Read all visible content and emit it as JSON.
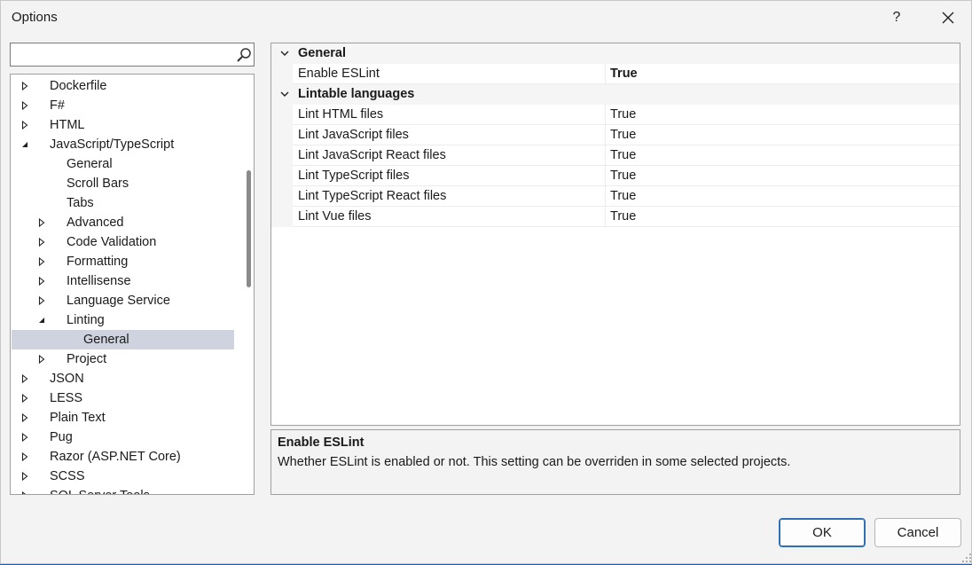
{
  "window": {
    "title": "Options",
    "help_label": "?",
    "close_label": "✕"
  },
  "search": {
    "placeholder": ""
  },
  "tree": {
    "items": [
      {
        "label": "Dockerfile",
        "indent": 0,
        "arrow": "collapsed"
      },
      {
        "label": "F#",
        "indent": 0,
        "arrow": "collapsed"
      },
      {
        "label": "HTML",
        "indent": 0,
        "arrow": "collapsed"
      },
      {
        "label": "JavaScript/TypeScript",
        "indent": 0,
        "arrow": "expanded"
      },
      {
        "label": "General",
        "indent": 1,
        "arrow": "none"
      },
      {
        "label": "Scroll Bars",
        "indent": 1,
        "arrow": "none"
      },
      {
        "label": "Tabs",
        "indent": 1,
        "arrow": "none"
      },
      {
        "label": "Advanced",
        "indent": 1,
        "arrow": "collapsed"
      },
      {
        "label": "Code Validation",
        "indent": 1,
        "arrow": "collapsed"
      },
      {
        "label": "Formatting",
        "indent": 1,
        "arrow": "collapsed"
      },
      {
        "label": "Intellisense",
        "indent": 1,
        "arrow": "collapsed"
      },
      {
        "label": "Language Service",
        "indent": 1,
        "arrow": "collapsed"
      },
      {
        "label": "Linting",
        "indent": 1,
        "arrow": "expanded"
      },
      {
        "label": "General",
        "indent": 2,
        "arrow": "none",
        "selected": true
      },
      {
        "label": "Project",
        "indent": 1,
        "arrow": "collapsed"
      },
      {
        "label": "JSON",
        "indent": 0,
        "arrow": "collapsed"
      },
      {
        "label": "LESS",
        "indent": 0,
        "arrow": "collapsed"
      },
      {
        "label": "Plain Text",
        "indent": 0,
        "arrow": "collapsed"
      },
      {
        "label": "Pug",
        "indent": 0,
        "arrow": "collapsed"
      },
      {
        "label": "Razor (ASP.NET Core)",
        "indent": 0,
        "arrow": "collapsed"
      },
      {
        "label": "SCSS",
        "indent": 0,
        "arrow": "collapsed"
      },
      {
        "label": "SQL Server Tools",
        "indent": 0,
        "arrow": "collapsed"
      }
    ]
  },
  "grid": {
    "categories": [
      {
        "label": "General",
        "properties": [
          {
            "name": "Enable ESLint",
            "value": "True",
            "bold": true
          }
        ]
      },
      {
        "label": "Lintable languages",
        "properties": [
          {
            "name": "Lint HTML files",
            "value": "True"
          },
          {
            "name": "Lint JavaScript files",
            "value": "True"
          },
          {
            "name": "Lint JavaScript React files",
            "value": "True"
          },
          {
            "name": "Lint TypeScript files",
            "value": "True"
          },
          {
            "name": "Lint TypeScript React files",
            "value": "True"
          },
          {
            "name": "Lint Vue files",
            "value": "True"
          }
        ]
      }
    ]
  },
  "description": {
    "title": "Enable ESLint",
    "text": "Whether ESLint is enabled or not. This setting can be overriden in some selected projects."
  },
  "buttons": {
    "ok_label": "OK",
    "cancel_label": "Cancel"
  },
  "colors": {
    "selected_row": "#cfd3e0",
    "ok_border": "#2f6fb7",
    "dialog_bg": "#f3f3f3"
  }
}
